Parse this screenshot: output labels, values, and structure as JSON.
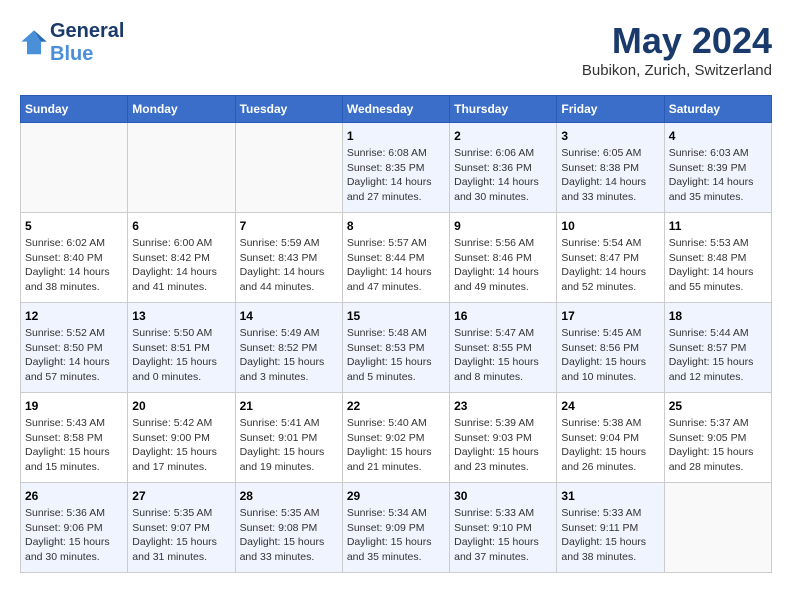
{
  "header": {
    "logo_general": "General",
    "logo_blue": "Blue",
    "month": "May 2024",
    "location": "Bubikon, Zurich, Switzerland"
  },
  "days_of_week": [
    "Sunday",
    "Monday",
    "Tuesday",
    "Wednesday",
    "Thursday",
    "Friday",
    "Saturday"
  ],
  "weeks": [
    [
      {
        "day": "",
        "info": ""
      },
      {
        "day": "",
        "info": ""
      },
      {
        "day": "",
        "info": ""
      },
      {
        "day": "1",
        "info": "Sunrise: 6:08 AM\nSunset: 8:35 PM\nDaylight: 14 hours\nand 27 minutes."
      },
      {
        "day": "2",
        "info": "Sunrise: 6:06 AM\nSunset: 8:36 PM\nDaylight: 14 hours\nand 30 minutes."
      },
      {
        "day": "3",
        "info": "Sunrise: 6:05 AM\nSunset: 8:38 PM\nDaylight: 14 hours\nand 33 minutes."
      },
      {
        "day": "4",
        "info": "Sunrise: 6:03 AM\nSunset: 8:39 PM\nDaylight: 14 hours\nand 35 minutes."
      }
    ],
    [
      {
        "day": "5",
        "info": "Sunrise: 6:02 AM\nSunset: 8:40 PM\nDaylight: 14 hours\nand 38 minutes."
      },
      {
        "day": "6",
        "info": "Sunrise: 6:00 AM\nSunset: 8:42 PM\nDaylight: 14 hours\nand 41 minutes."
      },
      {
        "day": "7",
        "info": "Sunrise: 5:59 AM\nSunset: 8:43 PM\nDaylight: 14 hours\nand 44 minutes."
      },
      {
        "day": "8",
        "info": "Sunrise: 5:57 AM\nSunset: 8:44 PM\nDaylight: 14 hours\nand 47 minutes."
      },
      {
        "day": "9",
        "info": "Sunrise: 5:56 AM\nSunset: 8:46 PM\nDaylight: 14 hours\nand 49 minutes."
      },
      {
        "day": "10",
        "info": "Sunrise: 5:54 AM\nSunset: 8:47 PM\nDaylight: 14 hours\nand 52 minutes."
      },
      {
        "day": "11",
        "info": "Sunrise: 5:53 AM\nSunset: 8:48 PM\nDaylight: 14 hours\nand 55 minutes."
      }
    ],
    [
      {
        "day": "12",
        "info": "Sunrise: 5:52 AM\nSunset: 8:50 PM\nDaylight: 14 hours\nand 57 minutes."
      },
      {
        "day": "13",
        "info": "Sunrise: 5:50 AM\nSunset: 8:51 PM\nDaylight: 15 hours\nand 0 minutes."
      },
      {
        "day": "14",
        "info": "Sunrise: 5:49 AM\nSunset: 8:52 PM\nDaylight: 15 hours\nand 3 minutes."
      },
      {
        "day": "15",
        "info": "Sunrise: 5:48 AM\nSunset: 8:53 PM\nDaylight: 15 hours\nand 5 minutes."
      },
      {
        "day": "16",
        "info": "Sunrise: 5:47 AM\nSunset: 8:55 PM\nDaylight: 15 hours\nand 8 minutes."
      },
      {
        "day": "17",
        "info": "Sunrise: 5:45 AM\nSunset: 8:56 PM\nDaylight: 15 hours\nand 10 minutes."
      },
      {
        "day": "18",
        "info": "Sunrise: 5:44 AM\nSunset: 8:57 PM\nDaylight: 15 hours\nand 12 minutes."
      }
    ],
    [
      {
        "day": "19",
        "info": "Sunrise: 5:43 AM\nSunset: 8:58 PM\nDaylight: 15 hours\nand 15 minutes."
      },
      {
        "day": "20",
        "info": "Sunrise: 5:42 AM\nSunset: 9:00 PM\nDaylight: 15 hours\nand 17 minutes."
      },
      {
        "day": "21",
        "info": "Sunrise: 5:41 AM\nSunset: 9:01 PM\nDaylight: 15 hours\nand 19 minutes."
      },
      {
        "day": "22",
        "info": "Sunrise: 5:40 AM\nSunset: 9:02 PM\nDaylight: 15 hours\nand 21 minutes."
      },
      {
        "day": "23",
        "info": "Sunrise: 5:39 AM\nSunset: 9:03 PM\nDaylight: 15 hours\nand 23 minutes."
      },
      {
        "day": "24",
        "info": "Sunrise: 5:38 AM\nSunset: 9:04 PM\nDaylight: 15 hours\nand 26 minutes."
      },
      {
        "day": "25",
        "info": "Sunrise: 5:37 AM\nSunset: 9:05 PM\nDaylight: 15 hours\nand 28 minutes."
      }
    ],
    [
      {
        "day": "26",
        "info": "Sunrise: 5:36 AM\nSunset: 9:06 PM\nDaylight: 15 hours\nand 30 minutes."
      },
      {
        "day": "27",
        "info": "Sunrise: 5:35 AM\nSunset: 9:07 PM\nDaylight: 15 hours\nand 31 minutes."
      },
      {
        "day": "28",
        "info": "Sunrise: 5:35 AM\nSunset: 9:08 PM\nDaylight: 15 hours\nand 33 minutes."
      },
      {
        "day": "29",
        "info": "Sunrise: 5:34 AM\nSunset: 9:09 PM\nDaylight: 15 hours\nand 35 minutes."
      },
      {
        "day": "30",
        "info": "Sunrise: 5:33 AM\nSunset: 9:10 PM\nDaylight: 15 hours\nand 37 minutes."
      },
      {
        "day": "31",
        "info": "Sunrise: 5:33 AM\nSunset: 9:11 PM\nDaylight: 15 hours\nand 38 minutes."
      },
      {
        "day": "",
        "info": ""
      }
    ]
  ]
}
